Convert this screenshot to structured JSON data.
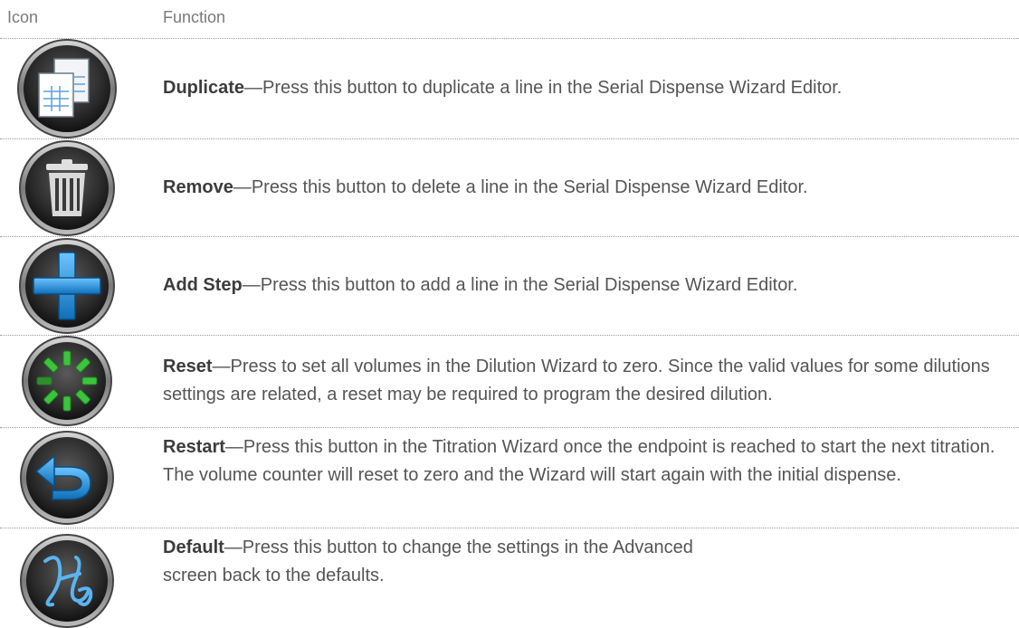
{
  "header": {
    "icon_col": "Icon",
    "function_col": "Function"
  },
  "rows": [
    {
      "icon": "duplicate-icon",
      "title": "Duplicate",
      "sep": "—",
      "text": "Press this button to duplicate a line in the Serial Dispense Wizard Editor."
    },
    {
      "icon": "trash-icon",
      "title": "Remove",
      "sep": "—",
      "text": "Press this button to delete a line in the Serial Dispense Wizard Editor."
    },
    {
      "icon": "plus-icon",
      "title": "Add Step",
      "sep": "—",
      "text": "Press this button to add a line in the Serial Dispense Wizard Editor."
    },
    {
      "icon": "reset-icon",
      "title": "Reset",
      "sep": "—",
      "text": "Press to set all volumes in the Dilution Wizard to zero. Since the valid values for some dilutions settings are related, a reset may be required to program the desired dilution."
    },
    {
      "icon": "restart-arrow-icon",
      "title": "Restart",
      "sep": "—",
      "text": "Press this button in the Titration Wizard once the endpoint is reached to start the next titration. The volume counter will reset to zero and the Wizard will start again with the initial dispense."
    },
    {
      "icon": "default-script-icon",
      "title": "Default",
      "sep": "—",
      "text": "Press this button to change the settings in the Advanced screen back to the defaults."
    }
  ],
  "colors": {
    "button_dark": "#2b2b2b",
    "accent_blue": "#1e8ad6",
    "accent_green": "#3cc43c",
    "text": "#555555"
  }
}
